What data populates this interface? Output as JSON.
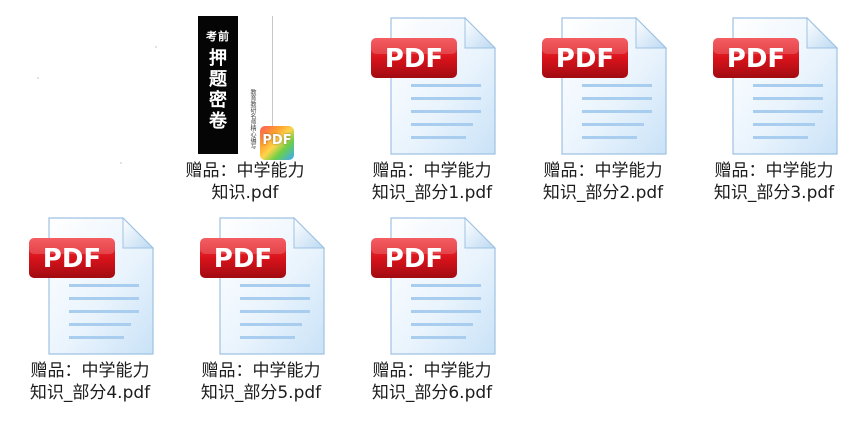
{
  "files": [
    {
      "line1": "赠品：中学能力",
      "line2": "知识.pdf",
      "thumbnail": "book-cover"
    },
    {
      "line1": "赠品：中学能力",
      "line2": "知识_部分1.pdf",
      "thumbnail": "pdf-icon"
    },
    {
      "line1": "赠品：中学能力",
      "line2": "知识_部分2.pdf",
      "thumbnail": "pdf-icon"
    },
    {
      "line1": "赠品：中学能力",
      "line2": "知识_部分3.pdf",
      "thumbnail": "pdf-icon"
    },
    {
      "line1": "赠品：中学能力",
      "line2": "知识_部分4.pdf",
      "thumbnail": "pdf-icon"
    },
    {
      "line1": "赠品：中学能力",
      "line2": "知识_部分5.pdf",
      "thumbnail": "pdf-icon"
    },
    {
      "line1": "赠品：中学能力",
      "line2": "知识_部分6.pdf",
      "thumbnail": "pdf-icon"
    }
  ],
  "pdf_icon": {
    "badge_text": "PDF",
    "badge_color": "#d9131b"
  },
  "book_cover": {
    "top_text": "考前",
    "title_chars": [
      "押",
      "题",
      "密",
      "卷"
    ],
    "side_text": "教育教研名师精心编写",
    "badge_text": "PDF"
  }
}
